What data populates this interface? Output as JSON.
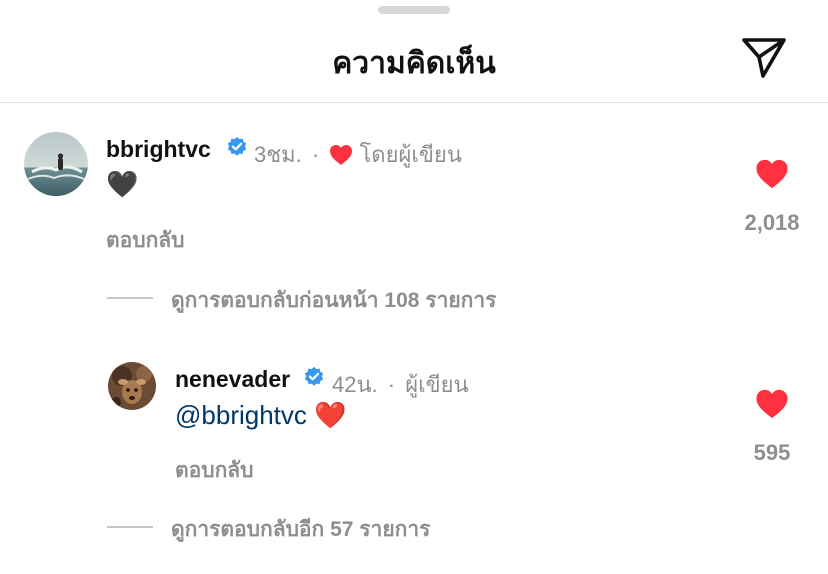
{
  "header": {
    "title": "ความคิดเห็น",
    "share_icon": "paper-plane-icon"
  },
  "colors": {
    "like_red": "#ff3040",
    "verified_blue": "#3897f0",
    "muted_text": "#8e8e8e",
    "mention_blue": "#00376b"
  },
  "comments": [
    {
      "username": "bbrightvc",
      "verified": true,
      "time": "3ชม.",
      "separator": "·",
      "author_liked_label": "โดยผู้เขียน",
      "text": "🖤",
      "reply_label": "ตอบกลับ",
      "likes": "2,018",
      "view_replies_label": "ดูการตอบกลับก่อนหน้า 108 รายการ"
    },
    {
      "username": "nenevader",
      "verified": true,
      "time": "42น.",
      "separator": "·",
      "author_label": "ผู้เขียน",
      "mention": "@bbrightvc",
      "text": "❤️",
      "reply_label": "ตอบกลับ",
      "likes": "595",
      "view_replies_label": "ดูการตอบกลับอีก 57 รายการ"
    }
  ]
}
